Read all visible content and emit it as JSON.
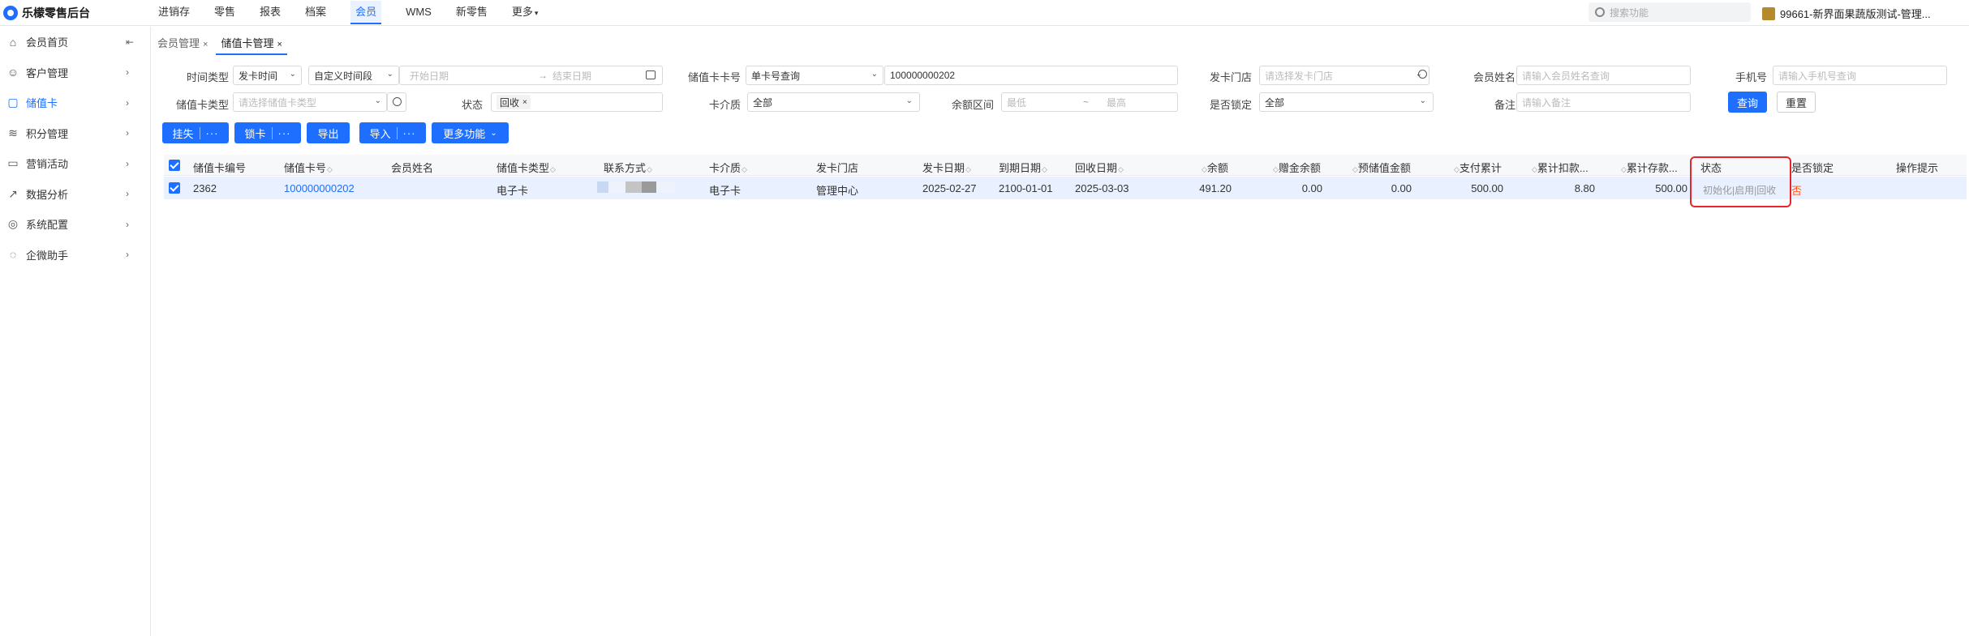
{
  "app": {
    "brand": "乐檬零售后台"
  },
  "nav": {
    "items": [
      "进销存",
      "零售",
      "报表",
      "档案",
      "会员",
      "WMS",
      "新零售",
      "更多"
    ],
    "active": "会员"
  },
  "search": {
    "placeholder": "搜索功能"
  },
  "user": {
    "label": "99661-新界面果蔬版测试-管理..."
  },
  "sidebar": {
    "items": [
      {
        "label": "会员首页",
        "icon": "home-icon"
      },
      {
        "label": "客户管理",
        "icon": "user-icon"
      },
      {
        "label": "储值卡",
        "icon": "card-icon"
      },
      {
        "label": "积分管理",
        "icon": "database-icon"
      },
      {
        "label": "营销活动",
        "icon": "monitor-icon"
      },
      {
        "label": "数据分析",
        "icon": "chart-icon"
      },
      {
        "label": "系统配置",
        "icon": "settings-icon"
      },
      {
        "label": "企微助手",
        "icon": "chat-icon"
      }
    ]
  },
  "tabs": [
    "会员管理",
    "储值卡管理"
  ],
  "filters": {
    "time_type_label": "时间类型",
    "time_type_value": "发卡时间",
    "time_range_value": "自定义时间段",
    "start_placeholder": "开始日期",
    "end_placeholder": "结束日期",
    "arrow": "→",
    "card_no_label": "储值卡卡号",
    "card_no_mode": "单卡号查询",
    "card_no_value": "100000000202",
    "store_label": "发卡门店",
    "store_placeholder": "请选择发卡门店",
    "member_name_label": "会员姓名",
    "member_name_placeholder": "请输入会员姓名查询",
    "phone_label": "手机号",
    "phone_placeholder": "请输入手机号查询",
    "card_type_label": "储值卡类型",
    "card_type_placeholder": "请选择储值卡类型",
    "status_label": "状态",
    "status_tag": "回收",
    "medium_label": "卡介质",
    "medium_value": "全部",
    "balance_label": "余额区间",
    "balance_min_placeholder": "最低",
    "balance_sep": "~",
    "balance_max_placeholder": "最高",
    "locked_label": "是否锁定",
    "locked_value": "全部",
    "remark_label": "备注",
    "remark_placeholder": "请输入备注",
    "query_button": "查询",
    "reset_button": "重置"
  },
  "actions": {
    "report_loss": "挂失",
    "lock": "锁卡",
    "export": "导出",
    "import": "导入",
    "more_functions": "更多功能",
    "dots": "···"
  },
  "table": {
    "headers": [
      "储值卡编号",
      "储值卡号",
      "会员姓名",
      "储值卡类型",
      "联系方式",
      "卡介质",
      "发卡门店",
      "发卡日期",
      "到期日期",
      "回收日期",
      "余额",
      "赠金余额",
      "预储值金额",
      "支付累计",
      "累计扣款...",
      "累计存款...",
      "状态",
      "是否锁定",
      "操作提示"
    ],
    "rows": [
      {
        "id": "2362",
        "card_no": "100000000202",
        "member_name": "",
        "card_type": "电子卡",
        "medium": "电子卡",
        "store": "管理中心",
        "issue_date": "2025-02-27",
        "expire_date": "2100-01-01",
        "recycle_date": "2025-03-03",
        "balance": "491.20",
        "bonus_balance": "0.00",
        "prestore": "0.00",
        "pay_total": "500.00",
        "deduct_total": "8.80",
        "deposit_total": "500.00",
        "status_ops": "初始化|启用|回收",
        "locked": "否",
        "tip": ""
      }
    ]
  },
  "colors": {
    "primary": "#1e6fff",
    "highlight": "#e6262b"
  }
}
